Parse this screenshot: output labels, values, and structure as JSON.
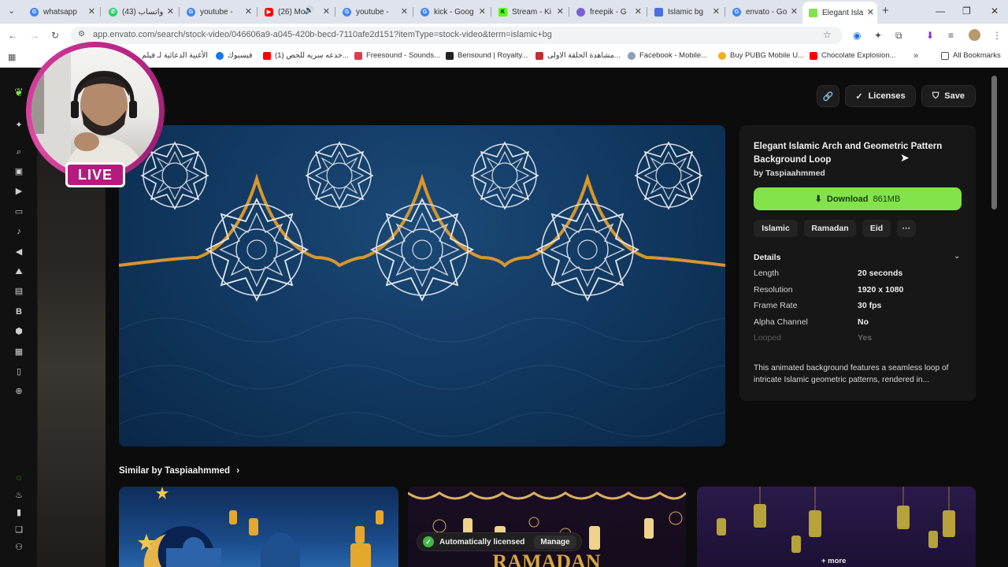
{
  "browser": {
    "tabs": [
      {
        "title": "whatsapp",
        "color": "#4285f4"
      },
      {
        "title": "(43) واتساب",
        "color": "#25d366"
      },
      {
        "title": "youtube -",
        "color": "#4285f4"
      },
      {
        "title": "(26) Mo",
        "color": "#ff0000"
      },
      {
        "title": "youtube -",
        "color": "#4285f4"
      },
      {
        "title": "kick - Goog",
        "color": "#4285f4"
      },
      {
        "title": "Stream - Ki",
        "color": "#53fc18"
      },
      {
        "title": "freepik - G",
        "color": "#7a5fd6"
      },
      {
        "title": "Islamic bg",
        "color": "#4a6ee0"
      },
      {
        "title": "envato - Go",
        "color": "#4285f4"
      },
      {
        "title": "Elegant Isla",
        "color": "#82e34b"
      }
    ],
    "url": "app.envato.com/search/stock-video/046606a9-a045-420b-becd-7110afe2d151?itemType=stock-video&term=islamic+bg",
    "bookmarks": [
      {
        "label": "الأغنية الدعائية لـ فيلم",
        "color": "#f5a623"
      },
      {
        "label": "فيسبوك",
        "color": "#1877f2"
      },
      {
        "label": "(1) خدعه سريه للحص...",
        "color": "#ff0000"
      },
      {
        "label": "Freesound - Sounds...",
        "color": "#e03c4e"
      },
      {
        "label": "Bensound | Royalty...",
        "color": "#222222"
      },
      {
        "label": "مشاهدة الحلقة الاولى...",
        "color": "#c03030"
      },
      {
        "label": "Facebook - Mobile...",
        "color": "#8aa0b8"
      },
      {
        "label": "Buy PUBG Mobile U...",
        "color": "#f2b01e"
      },
      {
        "label": "Chocolate Explosion...",
        "color": "#ff0000"
      }
    ],
    "all_bookmarks": "All Bookmarks"
  },
  "header_actions": {
    "licenses": "Licenses",
    "save": "Save"
  },
  "item": {
    "title": "Elegant Islamic Arch and Geometric Pattern Background Loop",
    "by": "by Taspiaahmmed",
    "download_label": "Download",
    "download_size": "861MB",
    "tags": [
      "Islamic",
      "Ramadan",
      "Eid",
      "···"
    ],
    "details_heading": "Details",
    "details": [
      {
        "label": "Length",
        "value": "20 seconds"
      },
      {
        "label": "Resolution",
        "value": "1920 x 1080"
      },
      {
        "label": "Frame Rate",
        "value": "30 fps"
      },
      {
        "label": "Alpha Channel",
        "value": "No"
      },
      {
        "label": "Looped",
        "value": "Yes"
      }
    ],
    "description": "This animated background features a seamless loop of intricate Islamic geometric patterns, rendered in..."
  },
  "similar": {
    "heading": "Similar by Taspiaahmmed",
    "more_label": "+ more"
  },
  "toast": {
    "text": "Automatically licensed",
    "action": "Manage"
  },
  "overlay": {
    "live_label": "LIVE"
  },
  "colors": {
    "accent_green": "#82e34b",
    "gold": "#d9962a",
    "preview_blue": "#123a63"
  }
}
